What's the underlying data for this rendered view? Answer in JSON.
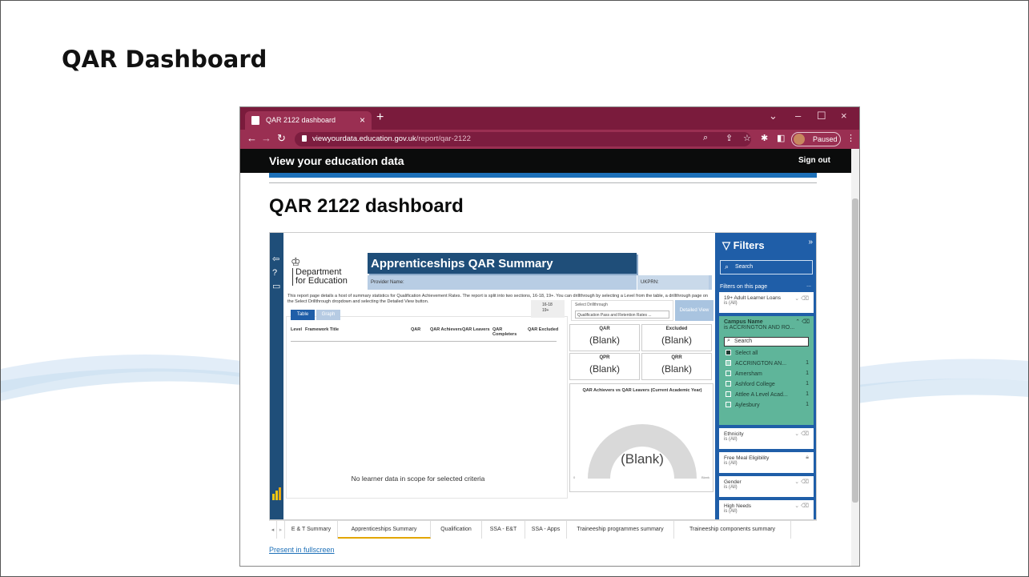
{
  "slide": {
    "title": "QAR Dashboard"
  },
  "browser": {
    "tab_title": "QAR 2122 dashboard",
    "url_host": "viewyourdata.education.gov.uk",
    "url_path": "/report/qar-2122",
    "profile_status": "Paused"
  },
  "site": {
    "title": "View your education data",
    "sign_out": "Sign out",
    "page_heading": "QAR 2122 dashboard",
    "present_link": "Present in fullscreen"
  },
  "report": {
    "dept_line1": "Department",
    "dept_line2": "for Education",
    "banner": "Apprenticeships QAR Summary",
    "provider_label": "Provider Name:",
    "ukprn_label": "UKPRN:",
    "description": "This report page details a host of summary statistics for Qualification Achievement Rates. The report is split into two sections, 16-18, 19+. You can drillthrough by selecting a Level from the table, a drillthrough page on the Select Drillthrough dropdown and selecting the Detailed View button.",
    "view_tabs": [
      "Table",
      "Graph"
    ],
    "age_options": [
      "16-18",
      "19+"
    ],
    "drill_label": "Select Drillthrough",
    "drill_value": "Qualification Pass and Retention Rates ...",
    "detailed_view": "Detailed View",
    "columns": [
      "Level",
      "Framework Title",
      "QAR",
      "QAR Achievers",
      "QAR Leavers",
      "QAR Completers",
      "QAR Excluded"
    ],
    "no_data": "No learner data in scope for selected criteria",
    "cards": [
      {
        "label": "QAR",
        "value": "(Blank)"
      },
      {
        "label": "Excluded",
        "value": "(Blank)"
      },
      {
        "label": "QPR",
        "value": "(Blank)"
      },
      {
        "label": "QRR",
        "value": "(Blank)"
      }
    ],
    "gauge": {
      "title": "QAR Achievers vs QAR Leavers (Current Academic Year)",
      "value": "(Blank)",
      "min_label": "0",
      "max_label": "Blank"
    }
  },
  "filters": {
    "title": "Filters",
    "search_placeholder": "Search",
    "on_page": "Filters on this page",
    "more": "...",
    "adult_loans": {
      "name": "19+ Adult Learner Loans",
      "state": "is (All)"
    },
    "campus": {
      "name": "Campus Name",
      "state": "is ACCRINGTON AND RO...",
      "search": "Search",
      "items": [
        {
          "label": "Select all",
          "count": ""
        },
        {
          "label": "ACCRINGTON AN...",
          "count": "1"
        },
        {
          "label": "Amersham",
          "count": "1"
        },
        {
          "label": "Ashford College",
          "count": "1"
        },
        {
          "label": "Attlee A Level Acad...",
          "count": "1"
        },
        {
          "label": "Aylesbury",
          "count": "1"
        }
      ]
    },
    "ethnicity": {
      "name": "Ethnicity",
      "state": "is (All)"
    },
    "fme": {
      "name": "Free Meal Eligibility",
      "state": "is (All)"
    },
    "gender": {
      "name": "Gender",
      "state": "is (All)"
    },
    "high_needs": {
      "name": "High Needs",
      "state": "is (All)"
    }
  },
  "page_tabs": [
    "E & T Summary",
    "Apprenticeships Summary",
    "Qualification",
    "SSA - E&T",
    "SSA - Apps",
    "Traineeship programmes summary",
    "Traineeship components summary"
  ],
  "colors": {
    "chrome_tab": "#7a1b3c",
    "report_navy": "#1f4e79",
    "filters_blue": "#1f5ea8",
    "campus_green": "#5fb59a",
    "gov_blue": "#1d70b8"
  }
}
